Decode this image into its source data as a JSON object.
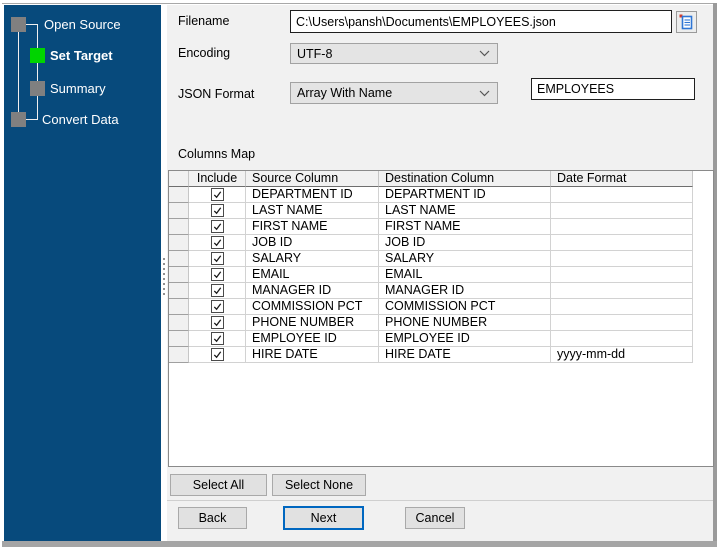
{
  "colors": {
    "sidebar-bg": "#074a7c",
    "step-active": "#00d400",
    "step-inactive": "#808080",
    "accent-focus": "#0067c0",
    "content-bg": "#f1f1f1",
    "control-bg": "#e4e4e4",
    "grid-line": "#d2d2d2"
  },
  "sidebar": {
    "steps": [
      {
        "label": "Open Source",
        "state": "done"
      },
      {
        "label": "Set Target",
        "state": "current"
      },
      {
        "label": "Summary",
        "state": "pending"
      },
      {
        "label": "Convert Data",
        "state": "pending"
      }
    ]
  },
  "form": {
    "filename_label": "Filename",
    "filename_value": "C:\\Users\\pansh\\Documents\\EMPLOYEES.json",
    "encoding_label": "Encoding",
    "encoding_value": "UTF-8",
    "json_format_label": "JSON Format",
    "json_format_value": "Array With Name",
    "array_name_value": "EMPLOYEES"
  },
  "columns_map": {
    "title": "Columns Map",
    "headers": {
      "include": "Include",
      "source": "Source Column",
      "destination": "Destination Column",
      "date_format": "Date Format"
    },
    "rows": [
      {
        "include": true,
        "source": "DEPARTMENT ID",
        "destination": "DEPARTMENT ID",
        "date_format": ""
      },
      {
        "include": true,
        "source": "LAST NAME",
        "destination": "LAST NAME",
        "date_format": ""
      },
      {
        "include": true,
        "source": "FIRST NAME",
        "destination": "FIRST NAME",
        "date_format": ""
      },
      {
        "include": true,
        "source": "JOB ID",
        "destination": "JOB ID",
        "date_format": ""
      },
      {
        "include": true,
        "source": "SALARY",
        "destination": "SALARY",
        "date_format": ""
      },
      {
        "include": true,
        "source": "EMAIL",
        "destination": "EMAIL",
        "date_format": ""
      },
      {
        "include": true,
        "source": "MANAGER ID",
        "destination": "MANAGER ID",
        "date_format": ""
      },
      {
        "include": true,
        "source": "COMMISSION PCT",
        "destination": "COMMISSION PCT",
        "date_format": ""
      },
      {
        "include": true,
        "source": "PHONE NUMBER",
        "destination": "PHONE NUMBER",
        "date_format": ""
      },
      {
        "include": true,
        "source": "EMPLOYEE ID",
        "destination": "EMPLOYEE ID",
        "date_format": ""
      },
      {
        "include": true,
        "source": "HIRE DATE",
        "destination": "HIRE DATE",
        "date_format": "yyyy-mm-dd"
      }
    ]
  },
  "buttons": {
    "select_all": "Select All",
    "select_none": "Select None",
    "back": "Back",
    "next": "Next",
    "cancel": "Cancel"
  }
}
